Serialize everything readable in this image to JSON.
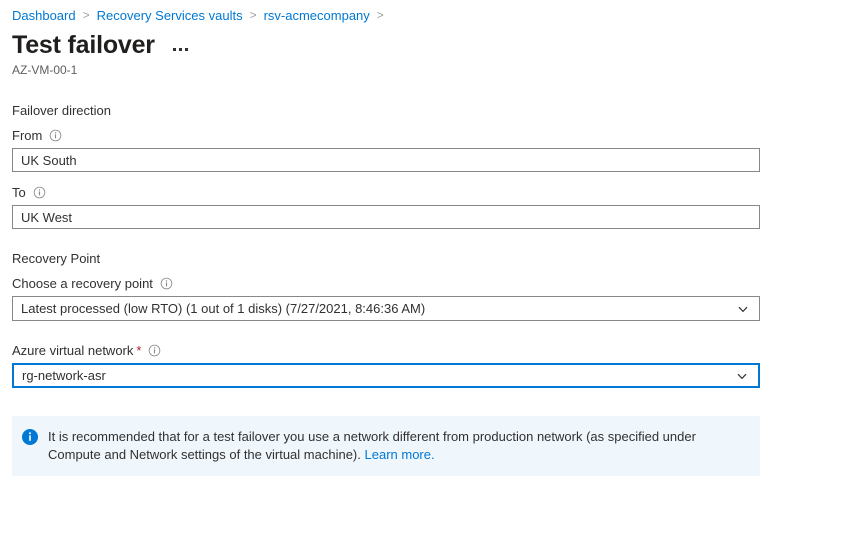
{
  "breadcrumb": {
    "separator": ">",
    "items": [
      {
        "label": "Dashboard"
      },
      {
        "label": "Recovery Services vaults"
      },
      {
        "label": "rsv-acmecompany"
      }
    ]
  },
  "header": {
    "title": "Test failover",
    "subtitle": "AZ-VM-00-1",
    "more_menu": "..."
  },
  "form": {
    "failover_direction": {
      "heading": "Failover direction",
      "from": {
        "label": "From",
        "value": "UK South"
      },
      "to": {
        "label": "To",
        "value": "UK West"
      }
    },
    "recovery_point": {
      "heading": "Recovery Point",
      "label": "Choose a recovery point",
      "value": "Latest processed (low RTO) (1 out of 1 disks) (7/27/2021, 8:46:36 AM)"
    },
    "virtual_network": {
      "label": "Azure virtual network",
      "required_marker": "*",
      "value": "rg-network-asr"
    }
  },
  "banner": {
    "text": "It is recommended that for a test failover you use a network different from production network (as specified under Compute and Network settings of the virtual machine).",
    "link_label": "Learn more."
  },
  "colors": {
    "accent": "#0078d4",
    "required": "#a4262c",
    "banner_background": "#eff6fc",
    "border": "#8a8886"
  }
}
